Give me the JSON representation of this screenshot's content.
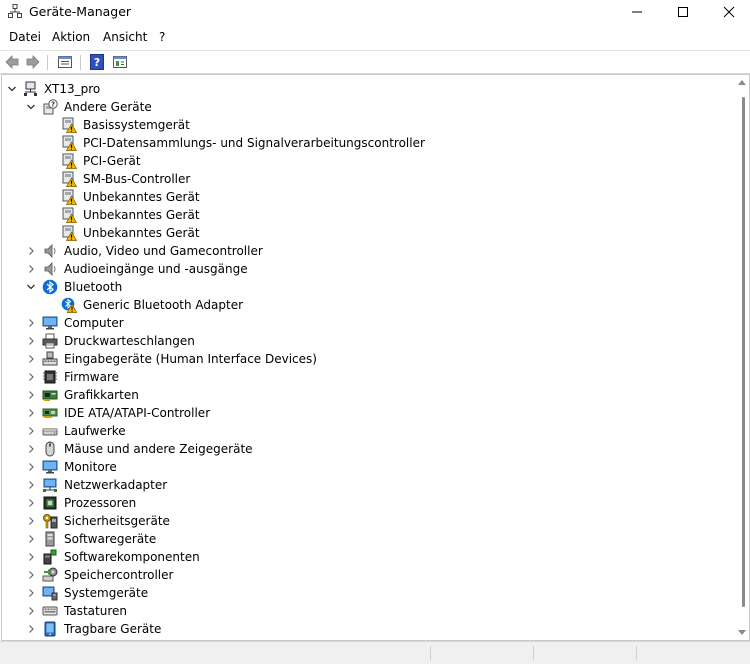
{
  "window": {
    "title": "Geräte-Manager"
  },
  "menu": [
    "Datei",
    "Aktion",
    "Ansicht",
    "?"
  ],
  "toolbar": {
    "buttons": [
      "back-arrow-icon",
      "forward-arrow-icon",
      "properties-icon",
      "help-icon",
      "view-icon"
    ]
  },
  "tree": {
    "root": {
      "label": "XT13_pro",
      "icon": "computer-tree-icon"
    },
    "nodes": [
      {
        "label": "Andere Geräte",
        "level": 1,
        "expander": "expanded",
        "icon": "unknown-device-icon"
      },
      {
        "label": "Basissystemgerät",
        "level": 2,
        "expander": "none",
        "icon": "warning-device-icon"
      },
      {
        "label": "PCI-Datensammlungs- und Signalverarbeitungscontroller",
        "level": 2,
        "expander": "none",
        "icon": "warning-device-icon"
      },
      {
        "label": "PCI-Gerät",
        "level": 2,
        "expander": "none",
        "icon": "warning-device-icon"
      },
      {
        "label": "SM-Bus-Controller",
        "level": 2,
        "expander": "none",
        "icon": "warning-device-icon"
      },
      {
        "label": "Unbekanntes Gerät",
        "level": 2,
        "expander": "none",
        "icon": "warning-device-icon"
      },
      {
        "label": "Unbekanntes Gerät",
        "level": 2,
        "expander": "none",
        "icon": "warning-device-icon"
      },
      {
        "label": "Unbekanntes Gerät",
        "level": 2,
        "expander": "none",
        "icon": "warning-device-icon"
      },
      {
        "label": "Audio, Video und Gamecontroller",
        "level": 1,
        "expander": "collapsed",
        "icon": "speaker-icon"
      },
      {
        "label": "Audioeingänge und -ausgänge",
        "level": 1,
        "expander": "collapsed",
        "icon": "speaker-icon"
      },
      {
        "label": "Bluetooth",
        "level": 1,
        "expander": "expanded",
        "icon": "bluetooth-icon"
      },
      {
        "label": "Generic Bluetooth Adapter",
        "level": 2,
        "expander": "none",
        "icon": "bluetooth-warning-icon"
      },
      {
        "label": "Computer",
        "level": 1,
        "expander": "collapsed",
        "icon": "monitor-icon"
      },
      {
        "label": "Druckwarteschlangen",
        "level": 1,
        "expander": "collapsed",
        "icon": "printer-icon"
      },
      {
        "label": "Eingabegeräte (Human Interface Devices)",
        "level": 1,
        "expander": "collapsed",
        "icon": "keyboard-hid-icon"
      },
      {
        "label": "Firmware",
        "level": 1,
        "expander": "collapsed",
        "icon": "chip-icon"
      },
      {
        "label": "Grafikkarten",
        "level": 1,
        "expander": "collapsed",
        "icon": "display-adapter-icon"
      },
      {
        "label": "IDE ATA/ATAPI-Controller",
        "level": 1,
        "expander": "collapsed",
        "icon": "controller-card-icon"
      },
      {
        "label": "Laufwerke",
        "level": 1,
        "expander": "collapsed",
        "icon": "disk-drive-icon"
      },
      {
        "label": "Mäuse und andere Zeigegeräte",
        "level": 1,
        "expander": "collapsed",
        "icon": "mouse-icon"
      },
      {
        "label": "Monitore",
        "level": 1,
        "expander": "collapsed",
        "icon": "monitor-icon"
      },
      {
        "label": "Netzwerkadapter",
        "level": 1,
        "expander": "collapsed",
        "icon": "network-adapter-icon"
      },
      {
        "label": "Prozessoren",
        "level": 1,
        "expander": "collapsed",
        "icon": "processor-icon"
      },
      {
        "label": "Sicherheitsgeräte",
        "level": 1,
        "expander": "collapsed",
        "icon": "security-key-icon"
      },
      {
        "label": "Softwaregeräte",
        "level": 1,
        "expander": "collapsed",
        "icon": "software-device-icon"
      },
      {
        "label": "Softwarekomponenten",
        "level": 1,
        "expander": "collapsed",
        "icon": "software-component-icon"
      },
      {
        "label": "Speichercontroller",
        "level": 1,
        "expander": "collapsed",
        "icon": "storage-controller-icon"
      },
      {
        "label": "Systemgeräte",
        "level": 1,
        "expander": "collapsed",
        "icon": "system-device-icon"
      },
      {
        "label": "Tastaturen",
        "level": 1,
        "expander": "collapsed",
        "icon": "keyboard-icon"
      },
      {
        "label": "Tragbare Geräte",
        "level": 1,
        "expander": "collapsed",
        "icon": "portable-device-icon"
      }
    ]
  },
  "colors": {
    "accent": "#1e63c4",
    "warning": "#f2b705",
    "bluetooth": "#0a6cd4"
  }
}
